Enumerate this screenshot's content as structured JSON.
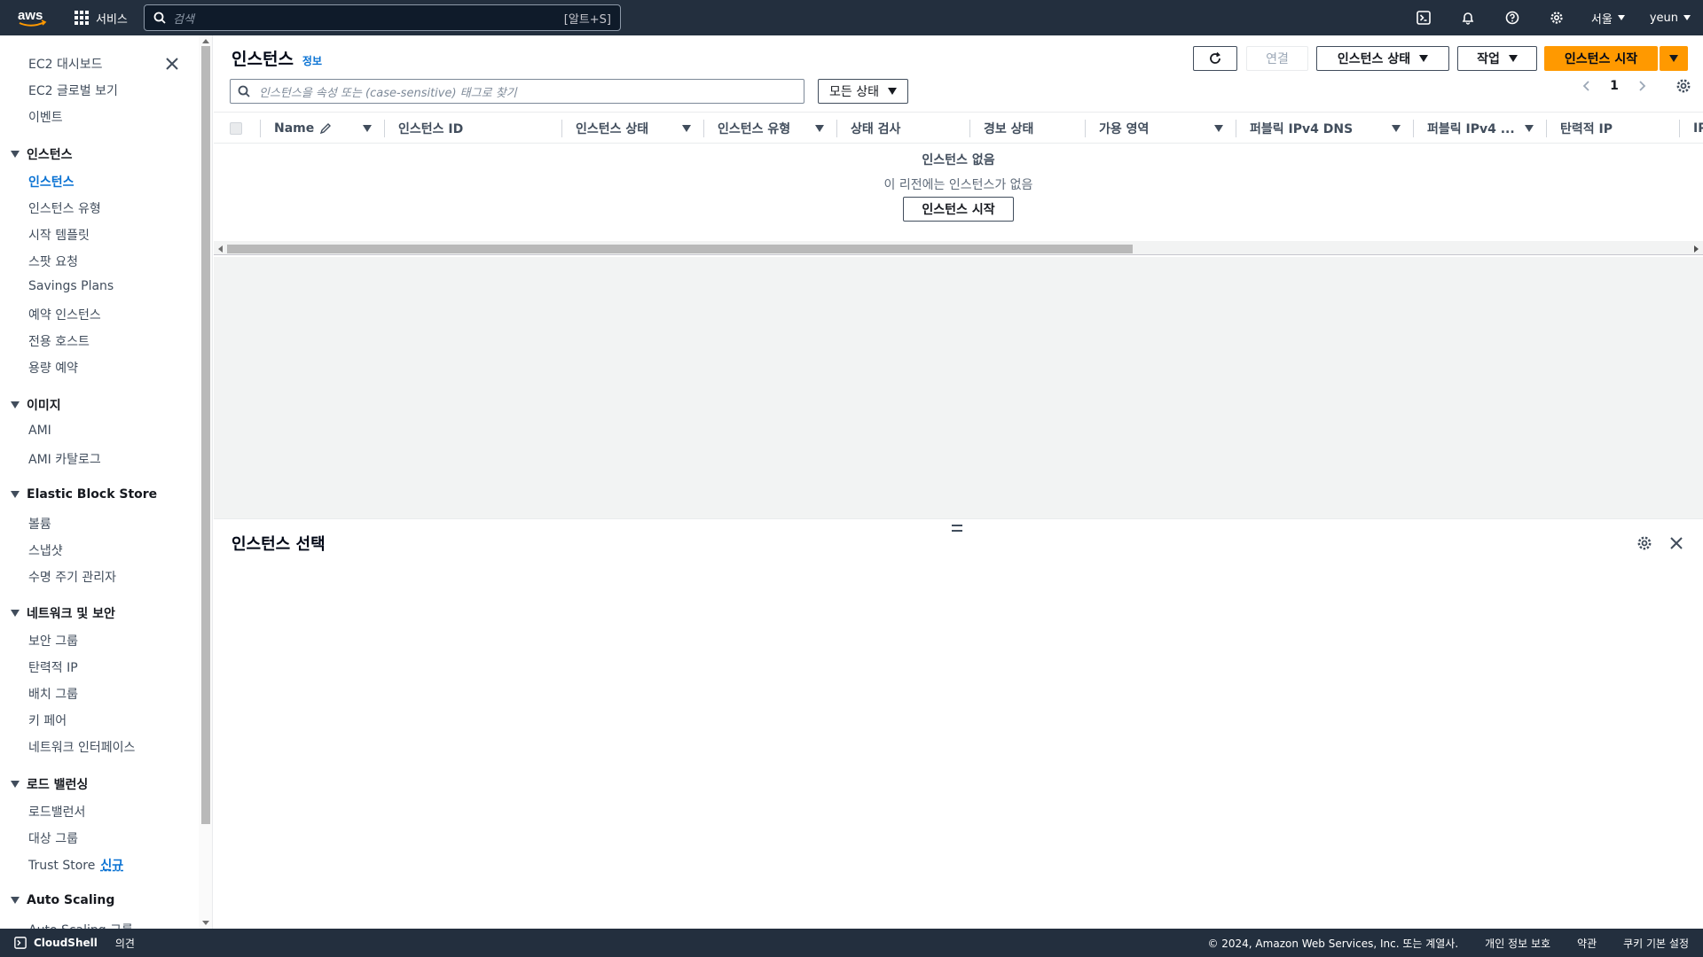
{
  "nav": {
    "services_label": "서비스",
    "search_placeholder": "검색",
    "search_shortcut": "[알트+S]",
    "region": "서울",
    "user": "yeun"
  },
  "sidebar": {
    "top_items": [
      "EC2 대시보드",
      "EC2 글로벌 보기",
      "이벤트"
    ],
    "sections": [
      {
        "title": "인스턴스",
        "items": [
          "인스턴스",
          "인스턴스 유형",
          "시작 템플릿",
          "스팟 요청",
          "Savings Plans",
          "예약 인스턴스",
          "전용 호스트",
          "용량 예약"
        ]
      },
      {
        "title": "이미지",
        "items": [
          "AMI",
          "AMI 카탈로그"
        ]
      },
      {
        "title": "Elastic Block Store",
        "items": [
          "볼륨",
          "스냅샷",
          "수명 주기 관리자"
        ]
      },
      {
        "title": "네트워크 및 보안",
        "items": [
          "보안 그룹",
          "탄력적 IP",
          "배치 그룹",
          "키 페어",
          "네트워크 인터페이스"
        ]
      },
      {
        "title": "로드 밸런싱",
        "items": [
          "로드밸런서",
          "대상 그룹",
          "Trust Store"
        ]
      },
      {
        "title": "Auto Scaling",
        "items": [
          "Auto Scaling 그룹"
        ]
      }
    ],
    "new_badge": "신규"
  },
  "main": {
    "title": "인스턴스",
    "info": "정보",
    "buttons": {
      "connect": "연결",
      "instance_state": "인스턴스 상태",
      "actions": "작업",
      "launch": "인스턴스 시작"
    },
    "filter_placeholder": "인스턴스을 속성 또는 (case-sensitive) 태그로 찾기",
    "state_filter": "모든 상태",
    "page": "1",
    "columns": [
      "Name",
      "인스턴스 ID",
      "인스턴스 상태",
      "인스턴스 유형",
      "상태 검사",
      "경보 상태",
      "가용 영역",
      "퍼블릭 IPv4 DNS",
      "퍼블릭 IPv4 ...",
      "탄력적 IP",
      "IP"
    ],
    "empty_title": "인스턴스 없음",
    "empty_desc": "이 리전에는 인스턴스가 없음",
    "empty_button": "인스턴스 시작",
    "split_title": "인스턴스 선택"
  },
  "footer": {
    "cloudshell": "CloudShell",
    "feedback": "의견",
    "copyright": "© 2024, Amazon Web Services, Inc. 또는 계열사.",
    "privacy": "개인 정보 보호",
    "terms": "약관",
    "cookies": "쿠키 기본 설정"
  },
  "colors": {
    "nav_bg": "#232f3e",
    "accent": "#0972d3",
    "primary_button": "#ff9900"
  }
}
